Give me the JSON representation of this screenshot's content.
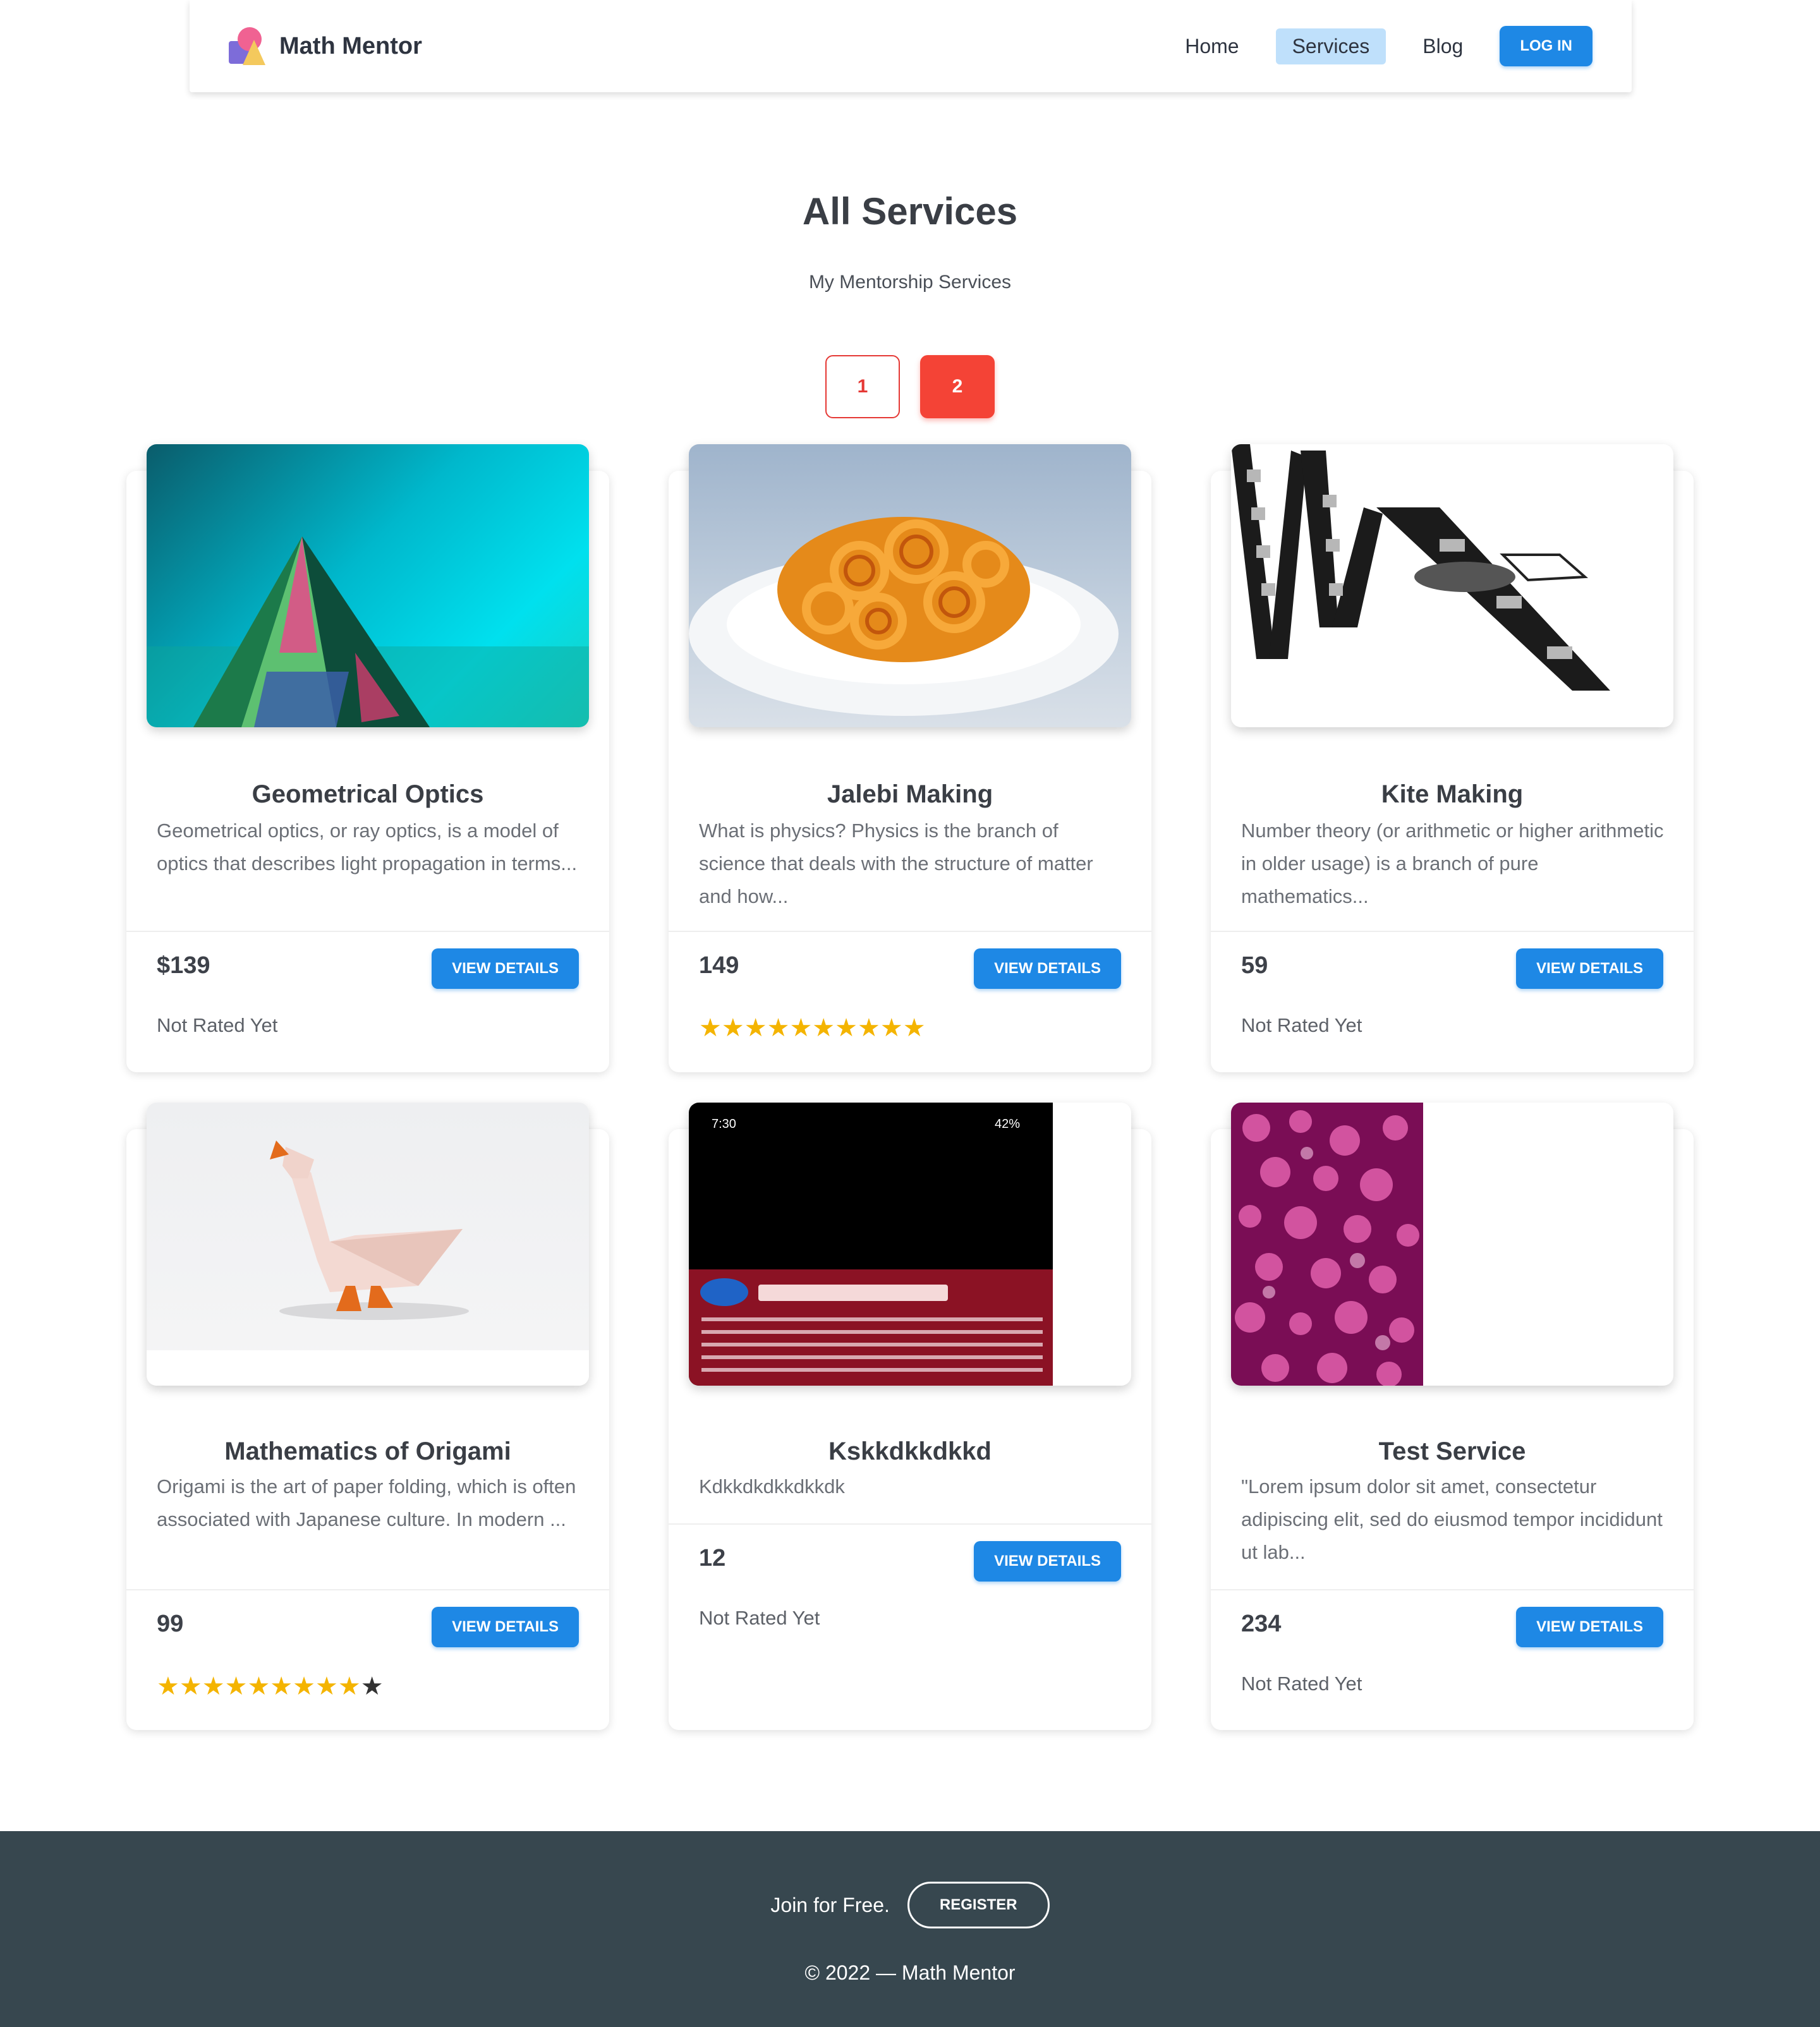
{
  "header": {
    "brand": "Math Mentor",
    "nav": [
      {
        "label": "Home",
        "active": false
      },
      {
        "label": "Services",
        "active": true
      },
      {
        "label": "Blog",
        "active": false
      }
    ],
    "login_label": "LOG IN"
  },
  "section": {
    "title": "All Services",
    "subtitle": "My Mentorship Services"
  },
  "pagination": {
    "pages": [
      "1",
      "2"
    ],
    "current": "2"
  },
  "services": [
    {
      "title": "Geometrical Optics",
      "description": "Geometrical optics, or ray optics, is a model of optics that describes light propagation in terms...",
      "price": "$139",
      "button": "VIEW DETAILS",
      "rating_text": "Not Rated Yet",
      "stars_filled": 0,
      "stars_total": 0,
      "image": "glass-pyramid-photo"
    },
    {
      "title": "Jalebi Making",
      "description": "What is physics? Physics is the branch of science that deals with the structure of matter and how...",
      "price": "149",
      "button": "VIEW DETAILS",
      "rating_text": "",
      "stars_filled": 10,
      "stars_total": 10,
      "image": "jalebi-plate-photo"
    },
    {
      "title": "Kite Making",
      "description": "Number theory (or arithmetic or higher arithmetic in older usage) is a branch of pure mathematics...",
      "price": "59",
      "button": "VIEW DETAILS",
      "rating_text": "Not Rated Yet",
      "stars_filled": 0,
      "stars_total": 0,
      "image": "film-strip-graphic"
    },
    {
      "title": "Mathematics of Origami",
      "description": "Origami is the art of paper folding, which is often associated with Japanese culture. In modern ...",
      "price": "99",
      "button": "VIEW DETAILS",
      "rating_text": "",
      "stars_filled": 9,
      "stars_total": 10,
      "image": "origami-duck-photo"
    },
    {
      "title": "Kskkdkkdkkd",
      "description": "Kdkkdkdkkdkkdk",
      "price": "12",
      "button": "VIEW DETAILS",
      "rating_text": "Not Rated Yet",
      "stars_filled": 0,
      "stars_total": 0,
      "image": "phone-screenshot",
      "image_status": {
        "time": "7:30",
        "battery": "42%"
      }
    },
    {
      "title": "Test Service",
      "description": "\"Lorem ipsum dolor sit amet, consectetur adipiscing elit, sed do eiusmod tempor incididunt ut lab...",
      "price": "234",
      "button": "VIEW DETAILS",
      "rating_text": "Not Rated Yet",
      "stars_filled": 0,
      "stars_total": 0,
      "image": "pink-bokeh-photo"
    }
  ],
  "footer": {
    "join_text": "Join for Free.",
    "register_label": "REGISTER",
    "copyright": "© 2022 — Math Mentor"
  },
  "colors": {
    "primary": "#1e88e5",
    "accent": "#f44336",
    "star": "#f4b400",
    "footer_bg": "#37474f"
  }
}
